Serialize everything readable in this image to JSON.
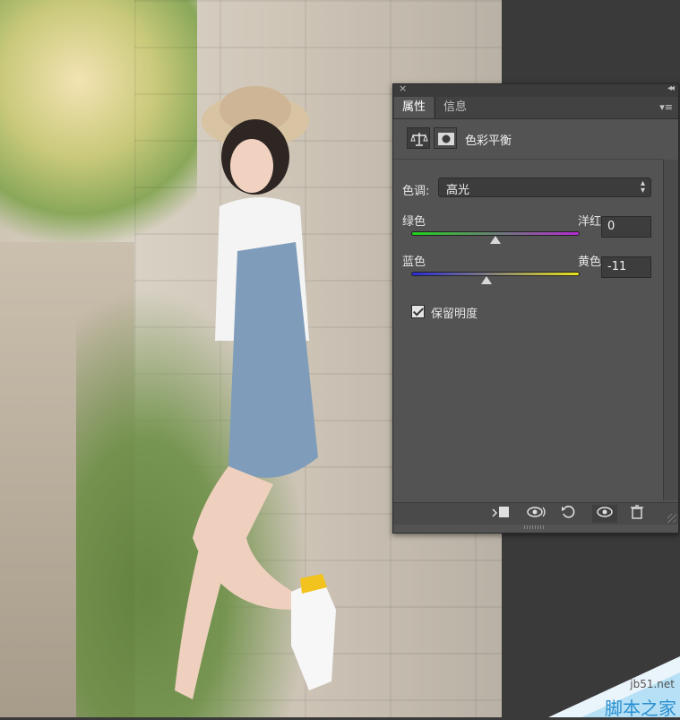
{
  "panel": {
    "close_glyph": "×",
    "collapse_glyph": "◂◂",
    "tabs": [
      {
        "label": "属性"
      },
      {
        "label": "信息"
      }
    ],
    "menu_glyph": "▾≡",
    "adjustment_title": "色彩平衡",
    "tone": {
      "label": "色调:",
      "value": "高光"
    },
    "sliders": [
      {
        "left_label": "绿色",
        "right_label": "洋红",
        "value": "0",
        "position": 0.5
      },
      {
        "left_label": "蓝色",
        "right_label": "黄色",
        "value": "-11",
        "position": 0.445
      }
    ],
    "preserve_luminosity": {
      "label": "保留明度",
      "checked": true
    }
  },
  "watermark": {
    "site": "jb51.net",
    "name": "脚本之家"
  },
  "colors": {
    "panel_bg": "#535353",
    "tab_bar": "#424242",
    "accent_watermark": "#2a8fd0"
  }
}
